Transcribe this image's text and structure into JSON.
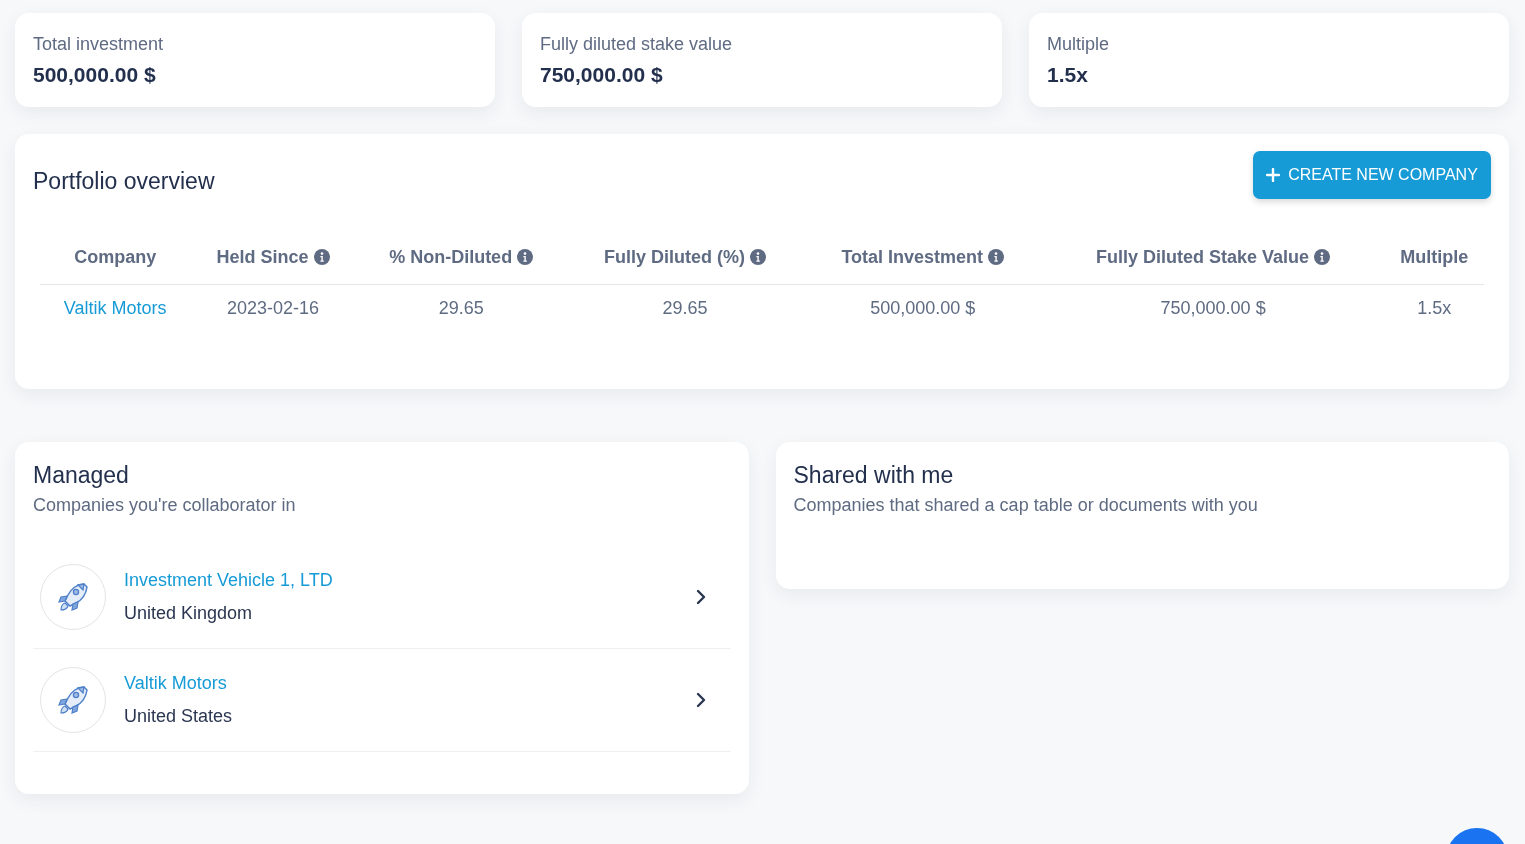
{
  "stats": [
    {
      "label": "Total investment",
      "value": "500,000.00 $"
    },
    {
      "label": "Fully diluted stake value",
      "value": "750,000.00 $"
    },
    {
      "label": "Multiple",
      "value": "1.5x"
    }
  ],
  "portfolio": {
    "title": "Portfolio overview",
    "create_button": "CREATE NEW COMPANY",
    "columns": [
      {
        "label": "Company",
        "info": false
      },
      {
        "label": "Held Since",
        "info": true
      },
      {
        "label": "% Non-Diluted",
        "info": true
      },
      {
        "label": "Fully Diluted (%)",
        "info": true
      },
      {
        "label": "Total Investment",
        "info": true
      },
      {
        "label": "Fully Diluted Stake Value",
        "info": true
      },
      {
        "label": "Multiple",
        "info": false
      }
    ],
    "rows": [
      [
        "Valtik Motors",
        "2023-02-16",
        "29.65",
        "29.65",
        "500,000.00 $",
        "750,000.00 $",
        "1.5x"
      ]
    ]
  },
  "managed": {
    "title": "Managed",
    "subtitle": "Companies you're collaborator in",
    "companies": [
      {
        "name": "Investment Vehicle 1, LTD",
        "country": "United Kingdom"
      },
      {
        "name": "Valtik Motors",
        "country": "United States"
      }
    ]
  },
  "shared": {
    "title": "Shared with me",
    "subtitle": "Companies that shared a cap table or documents with you"
  }
}
